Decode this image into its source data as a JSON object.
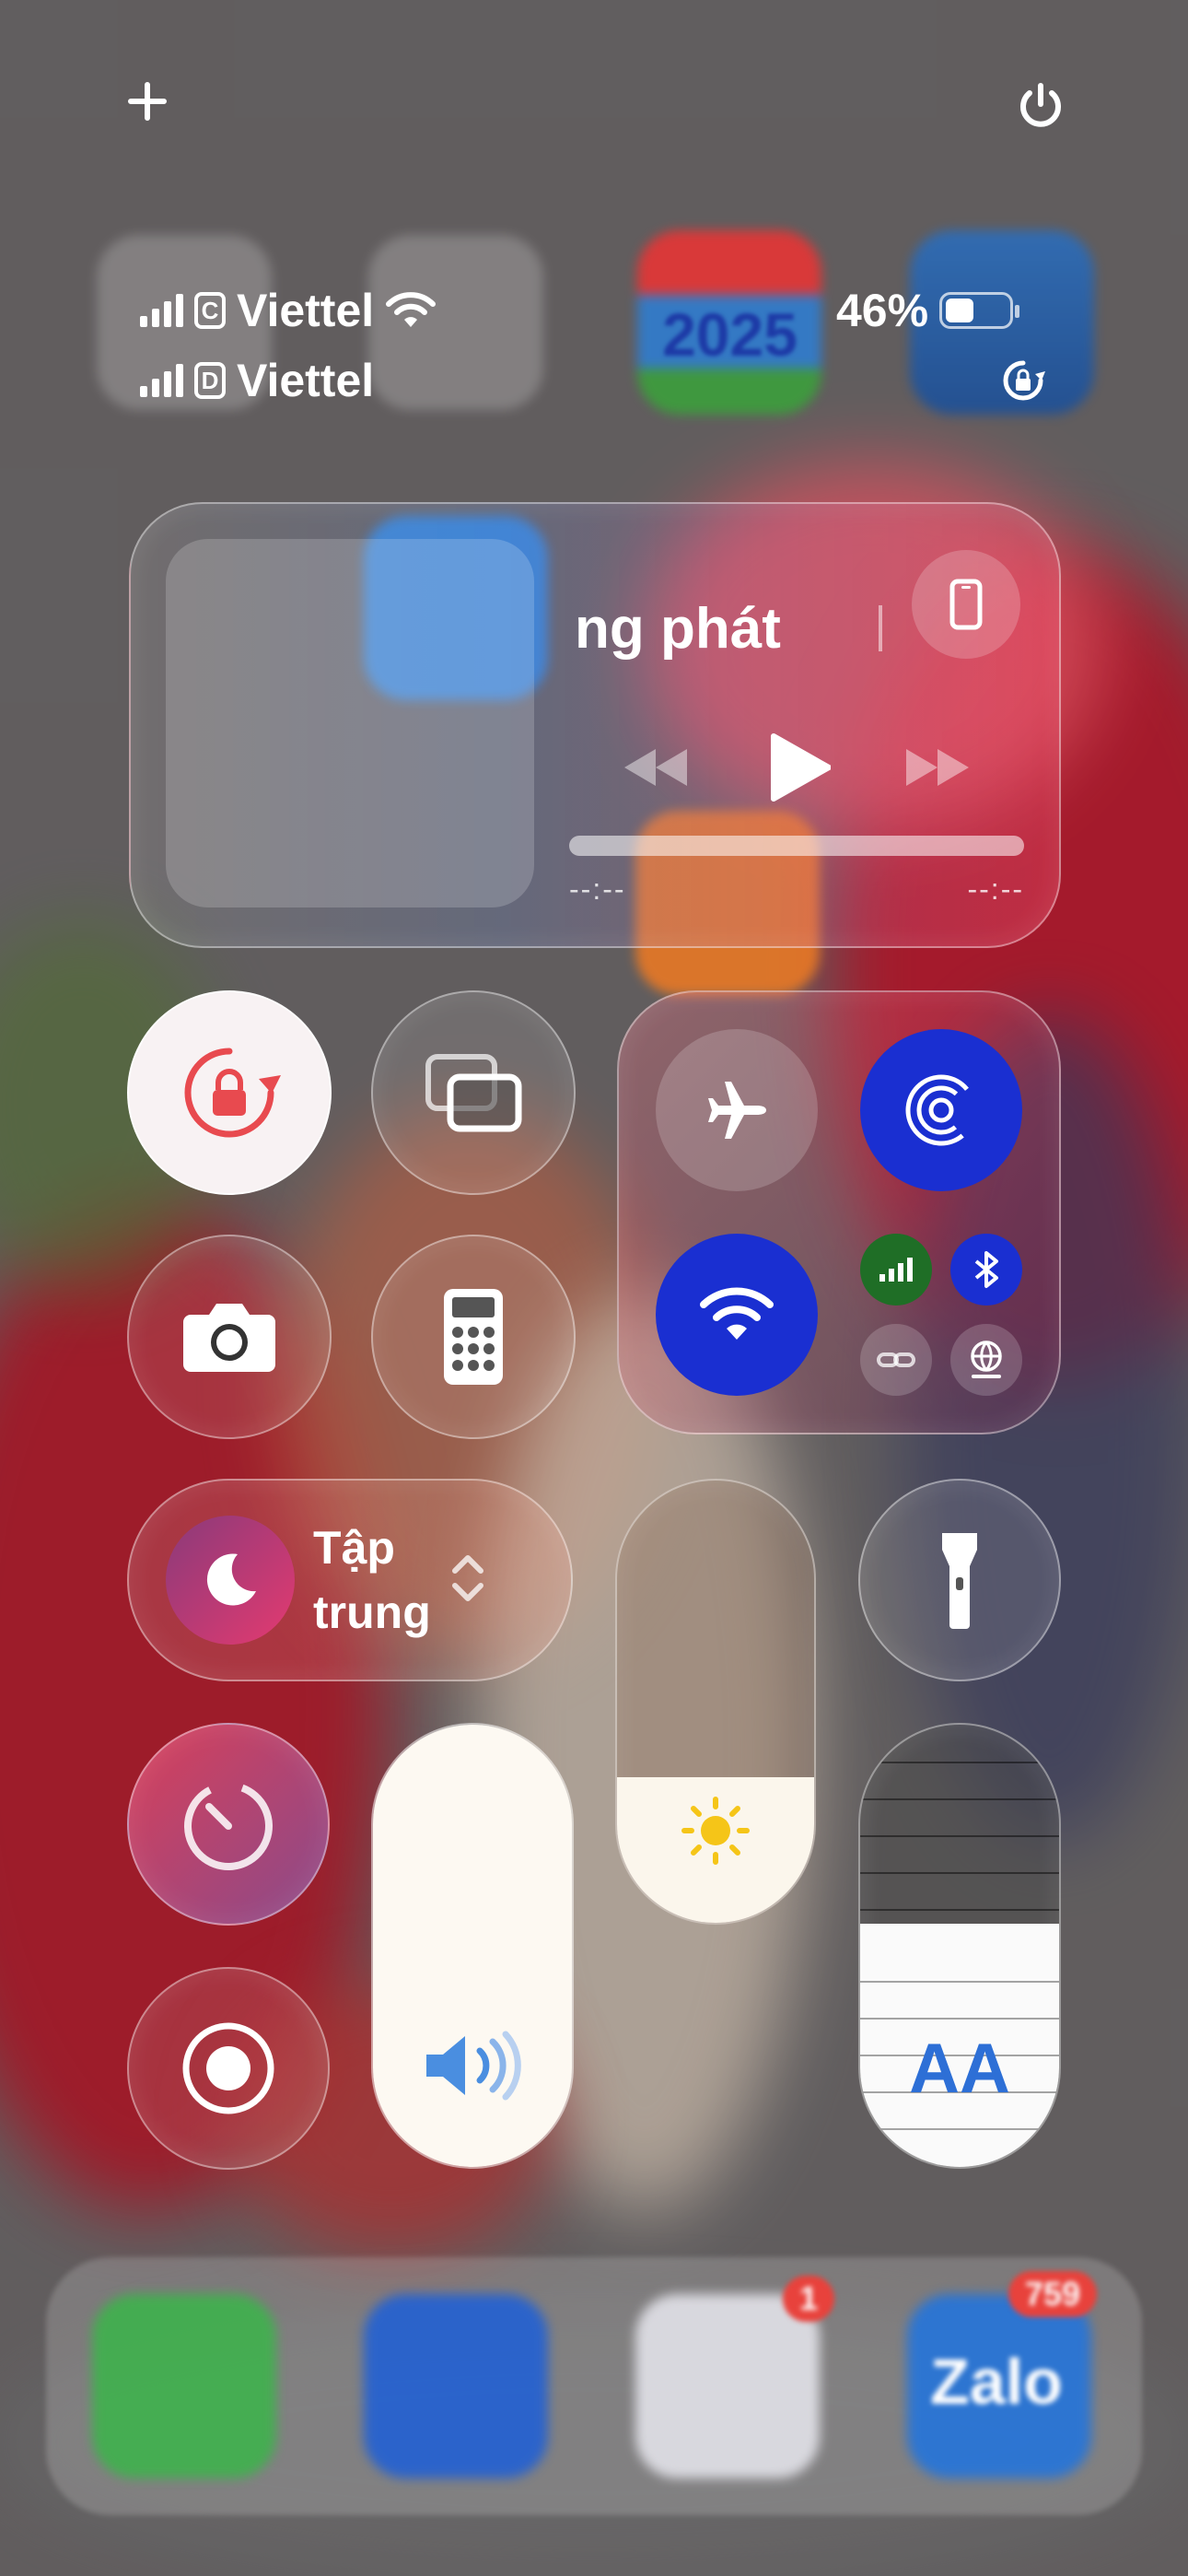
{
  "status_bar": {
    "sim1": {
      "label": "C",
      "carrier": "Viettel",
      "signal_bars": 4
    },
    "sim2": {
      "label": "D",
      "carrier": "Viettel",
      "signal_bars": 4
    },
    "battery_percent": "46%",
    "battery_level": 0.46
  },
  "home_icons": {
    "calendar_year": "2025",
    "messenger_badge": "1",
    "zalo_badge": "759",
    "zalo_label": "Zalo"
  },
  "media": {
    "title": "ng phát",
    "elapsed": "--:--",
    "remaining": "--:--"
  },
  "focus": {
    "label_line1": "Tập",
    "label_line2": "trung"
  },
  "sliders": {
    "volume_level": 1.0,
    "brightness_level": 0.33,
    "text_size_level": 0.55
  },
  "text_size": {
    "label": "AA"
  },
  "colors": {
    "airplane": "#e9474a",
    "airdrop": "#1a2fd1",
    "wifi": "#1a2fd1",
    "cellular": "#1f8e2c",
    "bluetooth": "#1a2fd1",
    "lock_rotation_active": "#e84a4f",
    "brightness_sun": "#f5c518"
  },
  "icons": [
    "plus-icon",
    "power-icon",
    "wifi-icon",
    "battery-icon",
    "rotation-lock-icon",
    "iphone-icon",
    "rewind-icon",
    "play-icon",
    "fast-forward-icon",
    "screen-mirroring-icon",
    "camera-icon",
    "calculator-icon",
    "airplane-icon",
    "airdrop-icon",
    "cellular-icon",
    "bluetooth-icon",
    "hotspot-icon",
    "vpn-globe-icon",
    "moon-icon",
    "chevron-updown-icon",
    "flashlight-icon",
    "timer-icon",
    "screen-record-icon",
    "speaker-icon",
    "sun-icon"
  ]
}
